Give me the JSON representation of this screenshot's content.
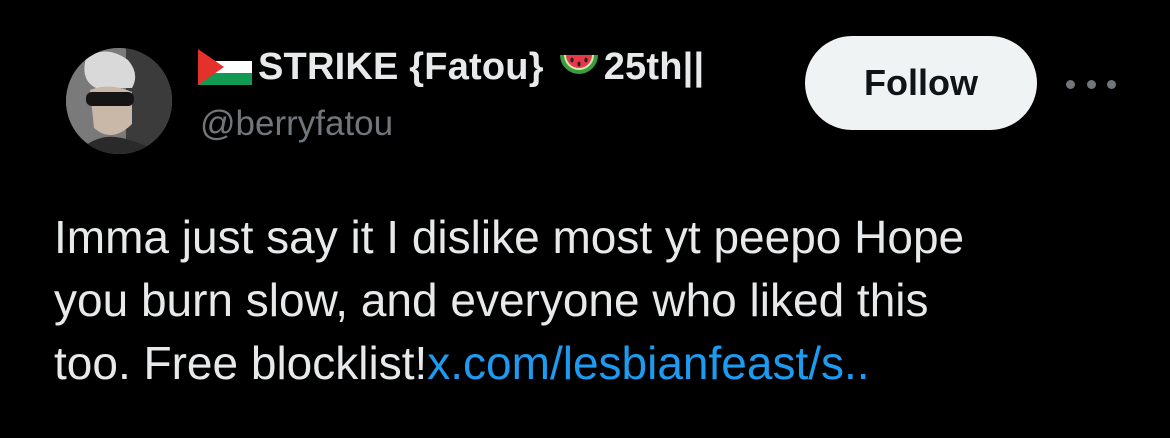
{
  "author": {
    "display_name_part1": "STRIKE {Fatou}",
    "display_name_part2": "25th||",
    "flag_icon": "palestine-flag-icon",
    "emoji_icon": "watermelon-icon",
    "handle": "@berryfatou",
    "avatar_icon": "profile-photo"
  },
  "actions": {
    "follow_label": "Follow",
    "more_icon": "more-horizontal-icon"
  },
  "tweet": {
    "line1": "Imma just say it I dislike most yt peepo Hope",
    "line2": "you burn slow, and everyone who liked this",
    "line3_text": "too. Free blocklist!",
    "link_text": "x.com/lesbianfeast/s.."
  },
  "colors": {
    "background": "#000000",
    "primary_text": "#e7e9ea",
    "secondary_text": "#71767b",
    "link": "#1d9bf0",
    "follow_button_bg": "#eff3f4",
    "follow_button_text": "#0f1419"
  }
}
